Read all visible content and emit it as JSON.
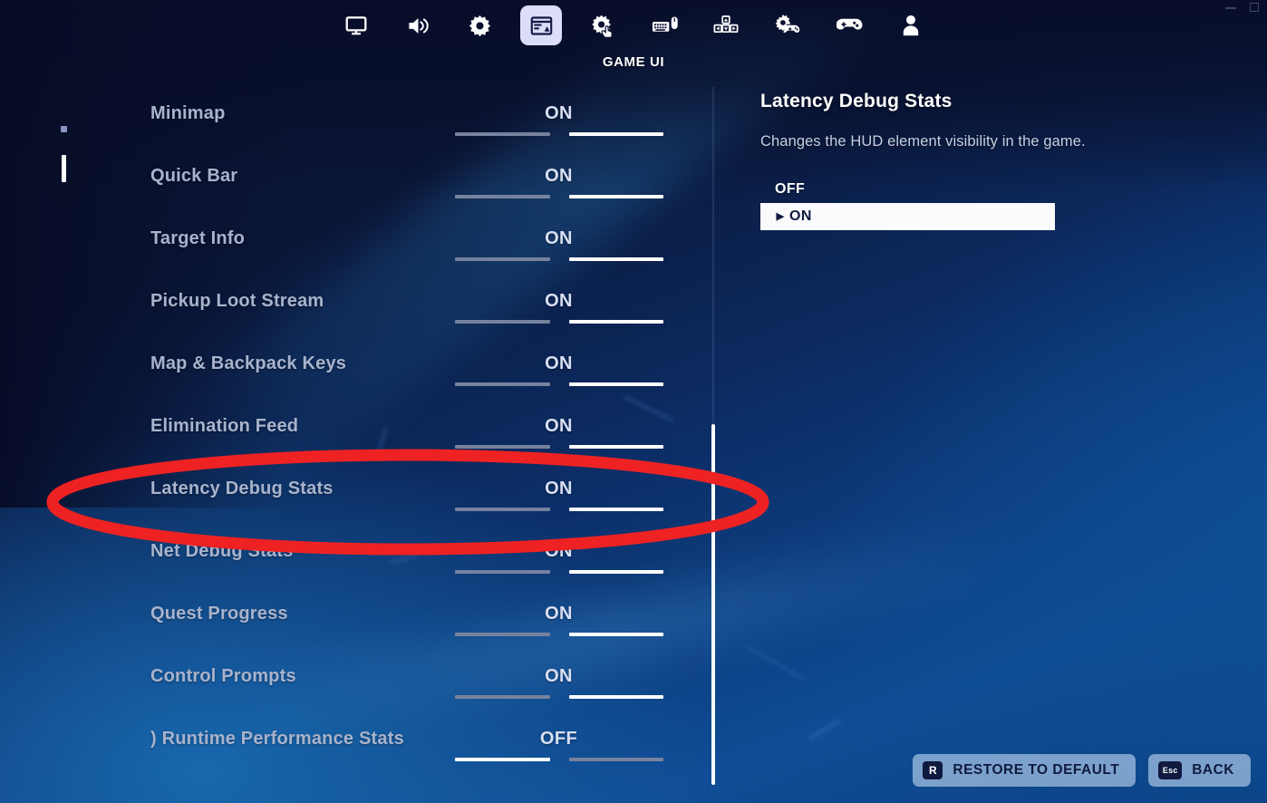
{
  "window": {
    "minimize_label": "minimize",
    "maximize_label": "maximize"
  },
  "topnav": {
    "active_label": "GAME UI",
    "items": [
      {
        "icon": "monitor-icon",
        "name": "tab-video",
        "active": false
      },
      {
        "icon": "speaker-icon",
        "name": "tab-audio",
        "active": false
      },
      {
        "icon": "gear-icon",
        "name": "tab-game",
        "active": false
      },
      {
        "icon": "game-ui-layout-icon",
        "name": "tab-game-ui",
        "active": true
      },
      {
        "icon": "gear-touch-icon",
        "name": "tab-touch",
        "active": false
      },
      {
        "icon": "keyboard-mouse-icon",
        "name": "tab-keyboard",
        "active": false
      },
      {
        "icon": "wasd-keys-icon",
        "name": "tab-movement",
        "active": false
      },
      {
        "icon": "gear-controller-icon",
        "name": "tab-controller",
        "active": false
      },
      {
        "icon": "controller-icon",
        "name": "tab-gamepad",
        "active": false
      },
      {
        "icon": "account-person-icon",
        "name": "tab-account",
        "active": false
      }
    ]
  },
  "page_indicator": {
    "dot_label": "page-dot",
    "bar_label": "page-bar"
  },
  "settings_list": {
    "rows": [
      {
        "label": "Minimap",
        "value": "ON"
      },
      {
        "label": "Quick Bar",
        "value": "ON"
      },
      {
        "label": "Target Info",
        "value": "ON"
      },
      {
        "label": "Pickup Loot Stream",
        "value": "ON"
      },
      {
        "label": "Map & Backpack Keys",
        "value": "ON"
      },
      {
        "label": "Elimination Feed",
        "value": "ON"
      },
      {
        "label": "Latency Debug Stats",
        "value": "ON"
      },
      {
        "label": "Net Debug Stats",
        "value": "ON"
      },
      {
        "label": "Quest Progress",
        "value": "ON"
      },
      {
        "label": "Control Prompts",
        "value": "ON"
      },
      {
        "label": ") Runtime Performance Stats",
        "value": "OFF"
      }
    ]
  },
  "detail": {
    "title": "Latency Debug Stats",
    "description": "Changes the HUD element visibility in the game.",
    "options": [
      {
        "label": "OFF",
        "selected": false
      },
      {
        "label": "ON",
        "selected": true
      }
    ],
    "caret": "▶"
  },
  "bottom_buttons": [
    {
      "key": "R",
      "label": "RESTORE TO DEFAULT",
      "name": "restore-to-default-button"
    },
    {
      "key": "Esc",
      "label": "BACK",
      "name": "back-button"
    }
  ],
  "annotation": {
    "type": "ellipse-highlight",
    "color": "#ee2222",
    "target": "Latency Debug Stats"
  },
  "colors": {
    "accent_white": "#ffffff",
    "bar_off": "#76829e",
    "label": "#a8b3cc",
    "active_tab_bg": "#dcddf7",
    "annotation_red": "#ee2222",
    "button_bg": "#a6c3e5"
  }
}
